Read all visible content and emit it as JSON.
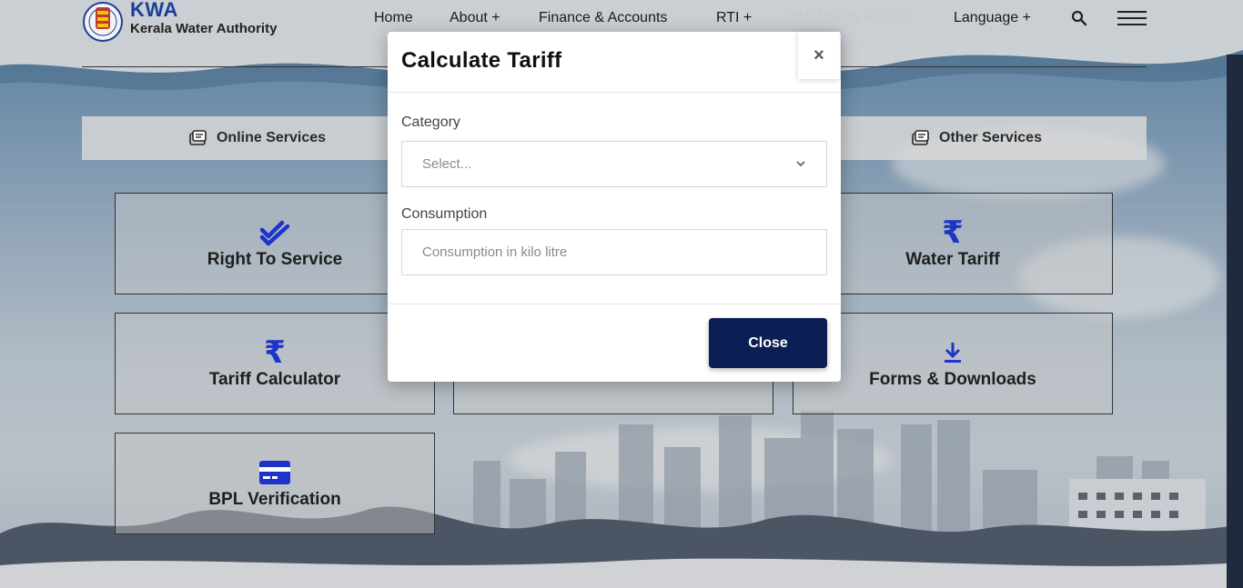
{
  "brand": {
    "short": "KWA",
    "long": "Kerala Water Authority"
  },
  "nav": {
    "home": "Home",
    "about": "About +",
    "finance": "Finance & Accounts",
    "rti": "RTI +",
    "jjm": "JJM Weekly Report",
    "language": "Language +"
  },
  "tabs": {
    "online": "Online Services",
    "other": "Other Services"
  },
  "cards": {
    "right_to_service": "Right To Service",
    "water_tariff": "Water Tariff",
    "tariff_calculator": "Tariff Calculator",
    "forms_downloads": "Forms & Downloads",
    "bpl_verification": "BPL Verification"
  },
  "modal": {
    "title": "Calculate Tariff",
    "close_x": "×",
    "category_label": "Category",
    "category_value": "Select...",
    "consumption_label": "Consumption",
    "consumption_placeholder": "Consumption in kilo litre",
    "close_button": "Close"
  },
  "icons": {
    "rupee_glyph": "₹"
  },
  "colors": {
    "accent": "#2040c8",
    "close_button_bg": "#0c1f55",
    "brand_blue": "#1a3f9a"
  }
}
